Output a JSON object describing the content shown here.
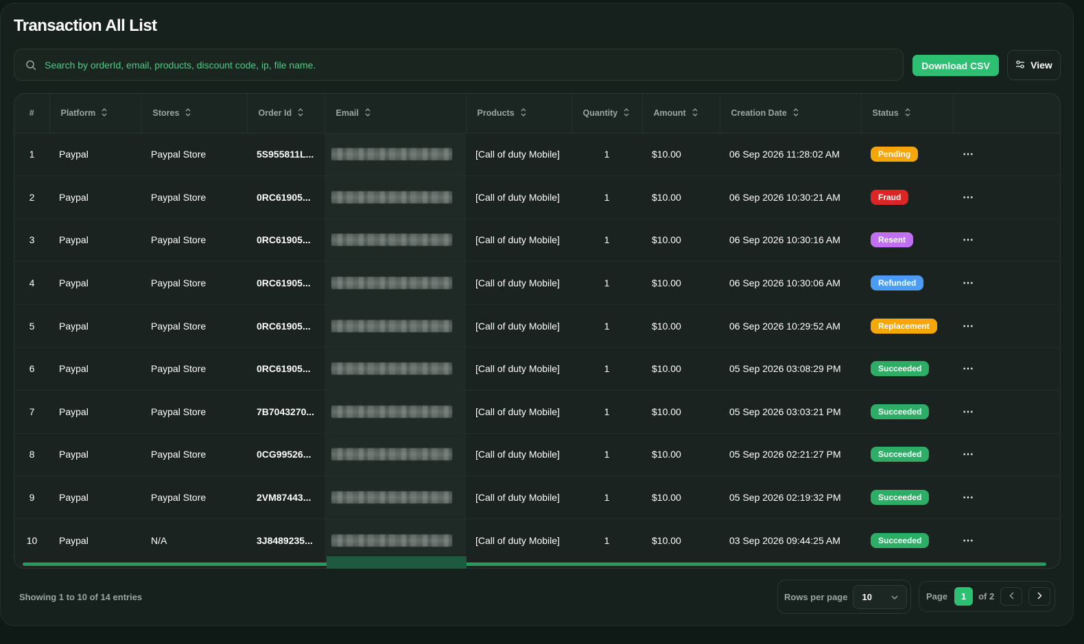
{
  "title": "Transaction All List",
  "search": {
    "placeholder": "Search by orderId, email, products, discount code, ip, file name."
  },
  "toolbar": {
    "download_label": "Download CSV",
    "view_label": "View"
  },
  "table": {
    "columns": [
      "#",
      "Platform",
      "Stores",
      "Order Id",
      "Email",
      "Products",
      "Quantity",
      "Amount",
      "Creation Date",
      "Status"
    ],
    "rows": [
      {
        "num": "1",
        "platform": "Paypal",
        "store": "Paypal Store",
        "order": "5S955811L...",
        "product": "[Call of duty Mobile]",
        "qty": "1",
        "amount": "$10.00",
        "date": "06 Sep 2026 11:28:02 AM",
        "status": "Pending",
        "status_color": "#f5a70a"
      },
      {
        "num": "2",
        "platform": "Paypal",
        "store": "Paypal Store",
        "order": "0RC61905...",
        "product": "[Call of duty Mobile]",
        "qty": "1",
        "amount": "$10.00",
        "date": "06 Sep 2026 10:30:21 AM",
        "status": "Fraud",
        "status_color": "#dc2626"
      },
      {
        "num": "3",
        "platform": "Paypal",
        "store": "Paypal Store",
        "order": "0RC61905...",
        "product": "[Call of duty Mobile]",
        "qty": "1",
        "amount": "$10.00",
        "date": "06 Sep 2026 10:30:16 AM",
        "status": "Resent",
        "status_color": "#c070f0"
      },
      {
        "num": "4",
        "platform": "Paypal",
        "store": "Paypal Store",
        "order": "0RC61905...",
        "product": "[Call of duty Mobile]",
        "qty": "1",
        "amount": "$10.00",
        "date": "06 Sep 2026 10:30:06 AM",
        "status": "Refunded",
        "status_color": "#4a9df5"
      },
      {
        "num": "5",
        "platform": "Paypal",
        "store": "Paypal Store",
        "order": "0RC61905...",
        "product": "[Call of duty Mobile]",
        "qty": "1",
        "amount": "$10.00",
        "date": "06 Sep 2026 10:29:52 AM",
        "status": "Replacement",
        "status_color": "#f5a70a"
      },
      {
        "num": "6",
        "platform": "Paypal",
        "store": "Paypal Store",
        "order": "0RC61905...",
        "product": "[Call of duty Mobile]",
        "qty": "1",
        "amount": "$10.00",
        "date": "05 Sep 2026 03:08:29 PM",
        "status": "Succeeded",
        "status_color": "#2ead66"
      },
      {
        "num": "7",
        "platform": "Paypal",
        "store": "Paypal Store",
        "order": "7B7043270...",
        "product": "[Call of duty Mobile]",
        "qty": "1",
        "amount": "$10.00",
        "date": "05 Sep 2026 03:03:21 PM",
        "status": "Succeeded",
        "status_color": "#2ead66"
      },
      {
        "num": "8",
        "platform": "Paypal",
        "store": "Paypal Store",
        "order": "0CG99526...",
        "product": "[Call of duty Mobile]",
        "qty": "1",
        "amount": "$10.00",
        "date": "05 Sep 2026 02:21:27 PM",
        "status": "Succeeded",
        "status_color": "#2ead66"
      },
      {
        "num": "9",
        "platform": "Paypal",
        "store": "Paypal Store",
        "order": "2VM87443...",
        "product": "[Call of duty Mobile]",
        "qty": "1",
        "amount": "$10.00",
        "date": "05 Sep 2026 02:19:32 PM",
        "status": "Succeeded",
        "status_color": "#2ead66"
      },
      {
        "num": "10",
        "platform": "Paypal",
        "store": "N/A",
        "order": "3J8489235...",
        "product": "[Call of duty Mobile]",
        "qty": "1",
        "amount": "$10.00",
        "date": "03 Sep 2026 09:44:25 AM",
        "status": "Succeeded",
        "status_color": "#2ead66"
      }
    ],
    "row_action_icon": "more-horizontal-icon"
  },
  "footer": {
    "showing": "Showing 1 to 10 of 14 entries",
    "rows_per_page_label": "Rows per page",
    "rows_per_page_value": "10",
    "page_label": "Page",
    "current_page": "1",
    "page_total": "of 2"
  },
  "colors": {
    "accent": "#2ec072",
    "background": "#16201c"
  }
}
